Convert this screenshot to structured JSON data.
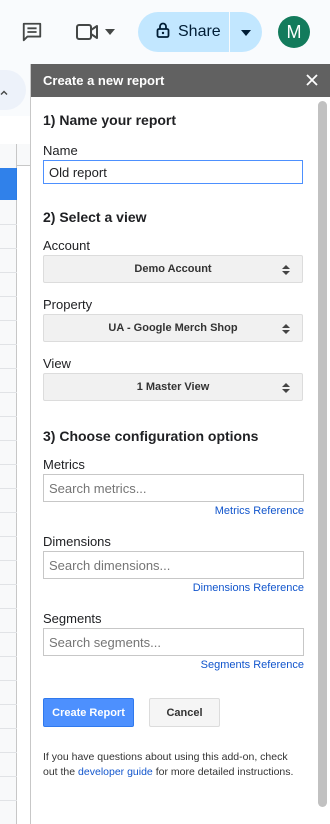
{
  "toolbar": {
    "share_label": "Share",
    "avatar_initial": "M",
    "colors": {
      "share_bg": "#c2e7ff",
      "avatar_bg": "#137b5c"
    }
  },
  "panel": {
    "title": "Create a new report",
    "section1": {
      "title": "1) Name your report",
      "name_label": "Name",
      "name_value": "Old report"
    },
    "section2": {
      "title": "2) Select a view",
      "account_label": "Account",
      "account_value": "Demo Account",
      "property_label": "Property",
      "property_value": "UA - Google Merch Shop",
      "view_label": "View",
      "view_value": "1 Master View"
    },
    "section3": {
      "title": "3) Choose configuration options",
      "metrics_label": "Metrics",
      "metrics_placeholder": "Search metrics...",
      "metrics_ref": "Metrics Reference",
      "dimensions_label": "Dimensions",
      "dimensions_placeholder": "Search dimensions...",
      "dimensions_ref": "Dimensions Reference",
      "segments_label": "Segments",
      "segments_placeholder": "Search segments...",
      "segments_ref": "Segments Reference"
    },
    "buttons": {
      "create": "Create Report",
      "cancel": "Cancel"
    },
    "help": {
      "before": "If you have questions about using this add-on, check out the",
      "link": "developer guide",
      "after": "for more detailed instructions."
    },
    "colors": {
      "header_bg": "#616161",
      "primary": "#4d90fe",
      "link": "#1155cc"
    }
  }
}
